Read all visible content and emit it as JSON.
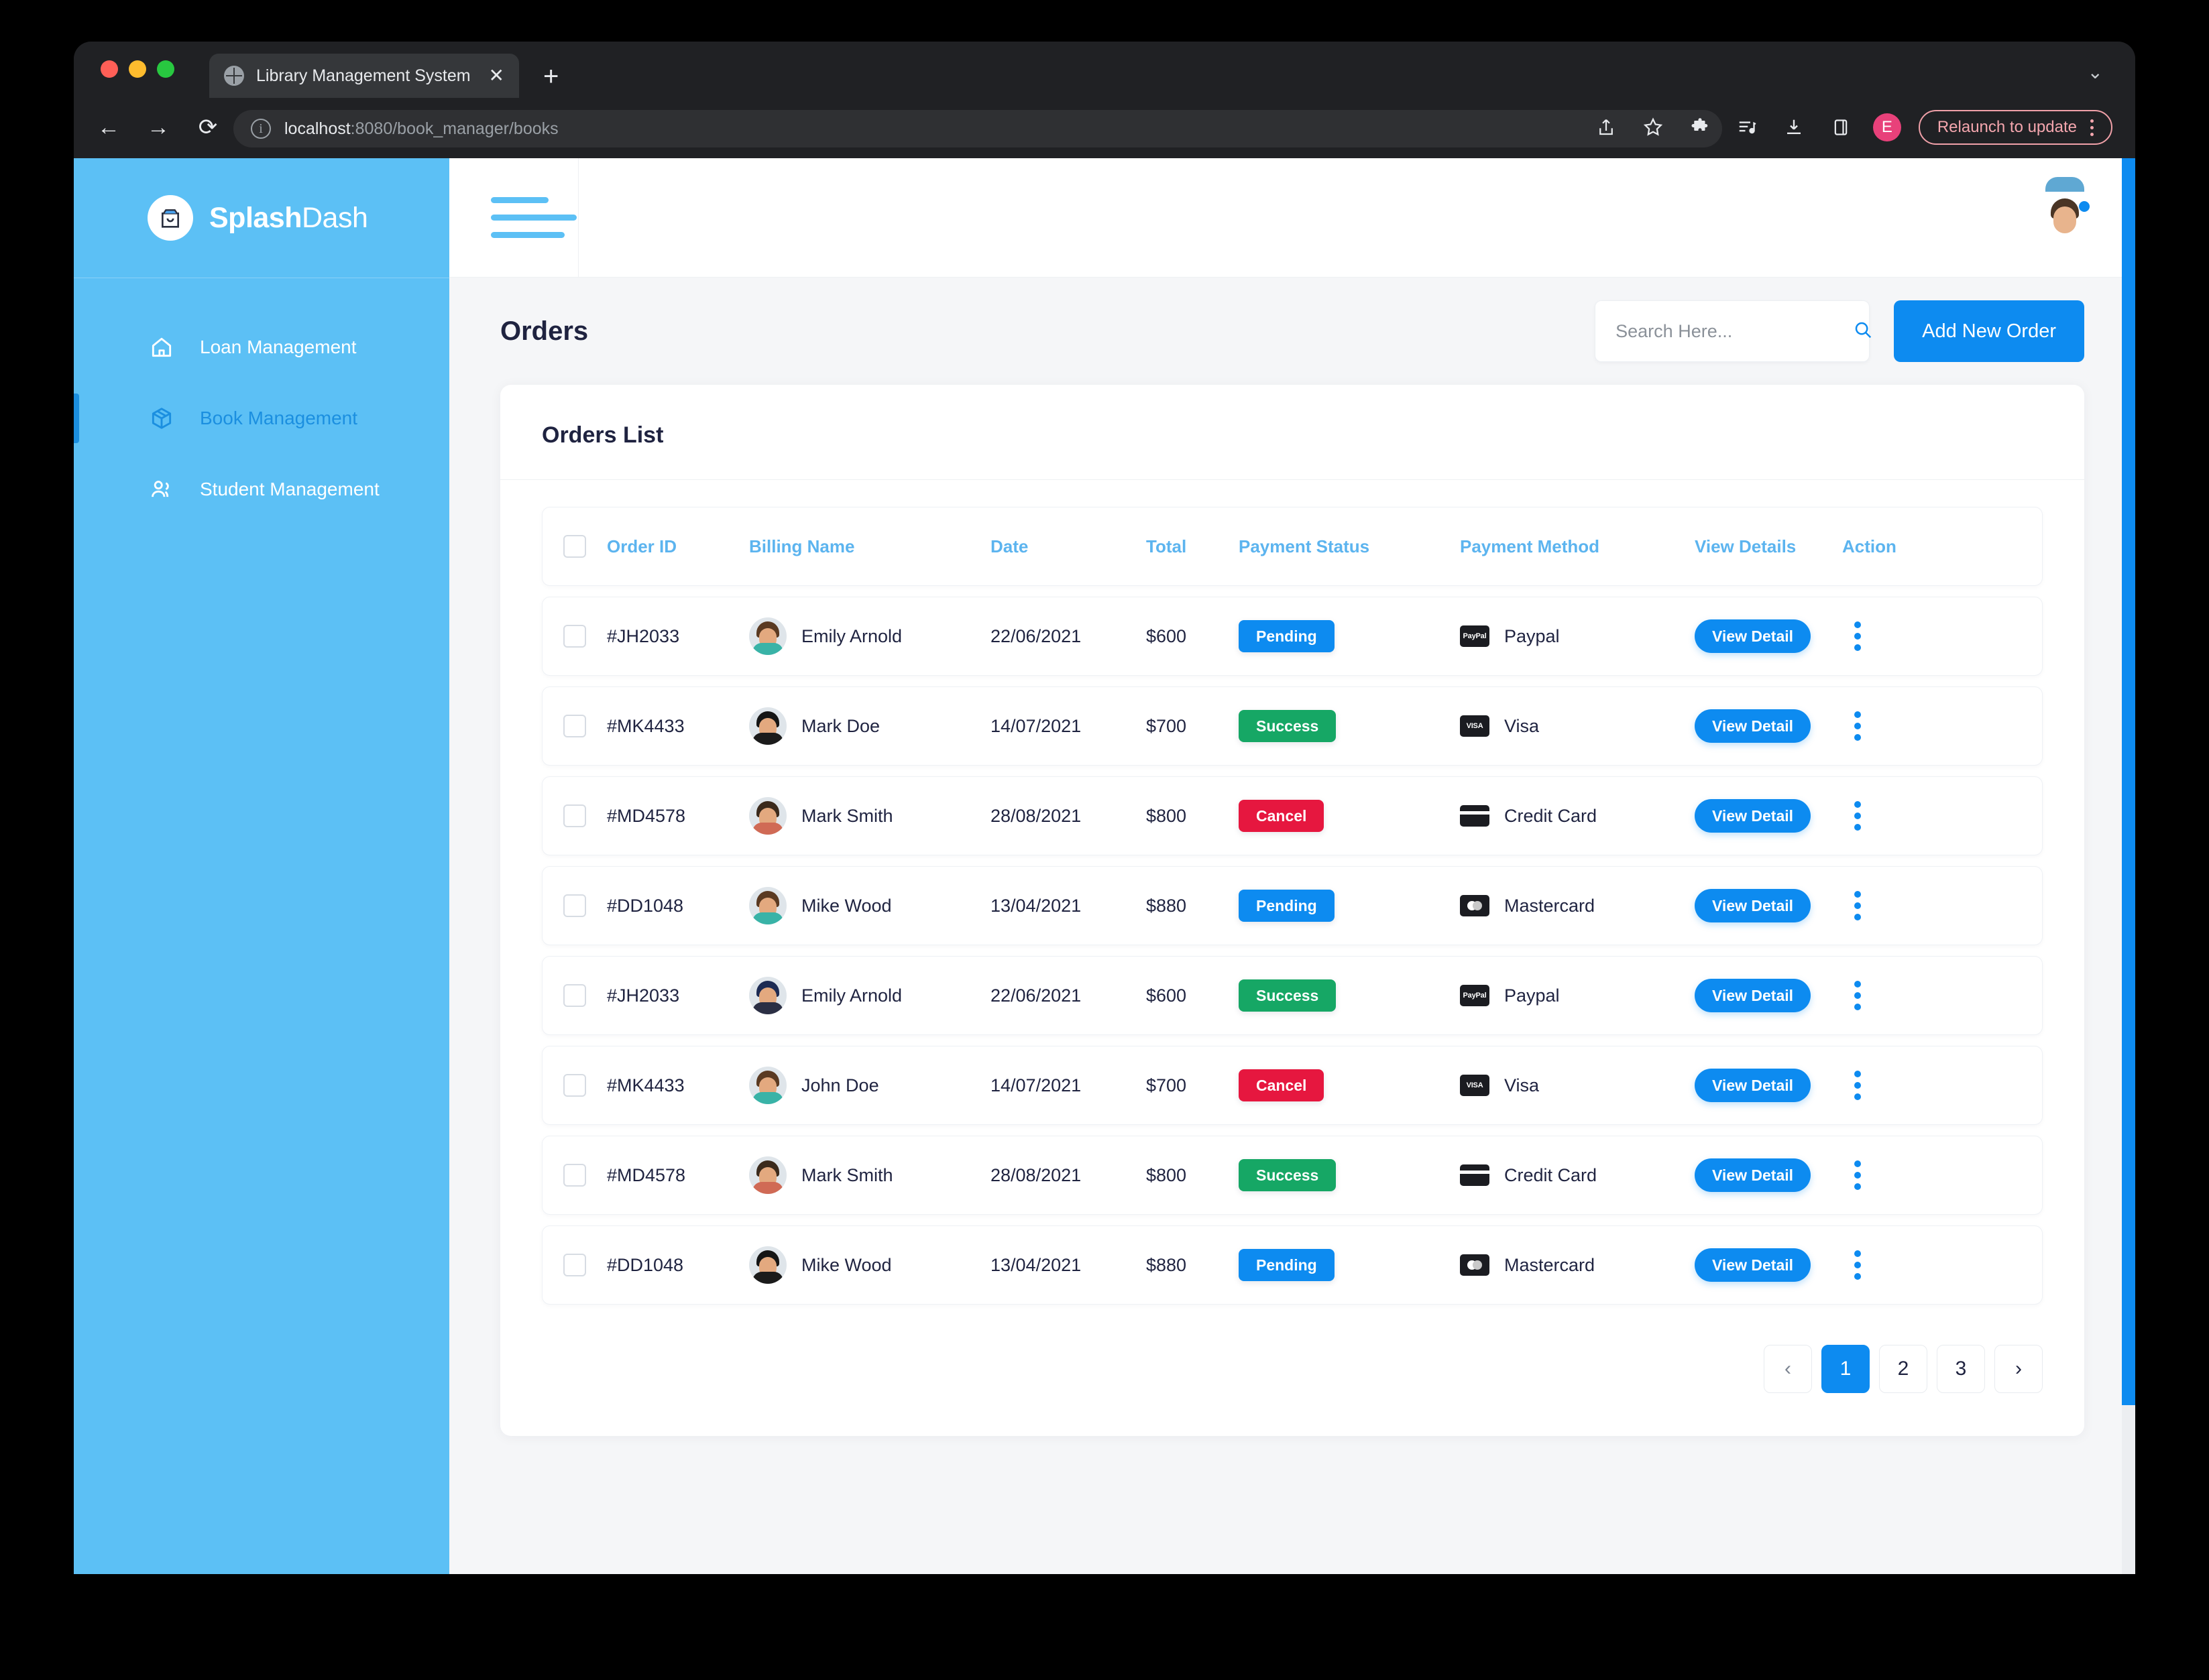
{
  "browser": {
    "tab_title": "Library Management System",
    "tab_close": "✕",
    "new_tab": "+",
    "tab_list_chevron": "⌄",
    "back": "←",
    "forward": "→",
    "reload": "⟳",
    "info_icon": "i",
    "url_host": "localhost",
    "url_path": ":8080/book_manager/books",
    "profile_initial": "E",
    "relaunch_label": "Relaunch to update"
  },
  "sidebar": {
    "brand_bold": "Splash",
    "brand_light": "Dash",
    "items": [
      {
        "label": "Loan Management",
        "icon": "home-icon",
        "active": false
      },
      {
        "label": "Book Management",
        "icon": "package-icon",
        "active": true
      },
      {
        "label": "Student Management",
        "icon": "users-icon",
        "active": false
      }
    ]
  },
  "topbar": {
    "menu_icon": "hamburger-icon",
    "avatar_icon": "user-avatar"
  },
  "page": {
    "title": "Orders",
    "search_placeholder": "Search Here...",
    "search_value": "",
    "search_icon": "search-icon",
    "add_button": "Add New Order",
    "card_title": "Orders List"
  },
  "table": {
    "columns": [
      "",
      "Order ID",
      "Billing Name",
      "Date",
      "Total",
      "Payment Status",
      "Payment Method",
      "View Details",
      "Action"
    ],
    "view_detail_label": "View Detail",
    "rows": [
      {
        "order_id": "#JH2033",
        "billing_name": "Emily Arnold",
        "date": "22/06/2021",
        "total": "$600",
        "status": "Pending",
        "status_kind": "pending",
        "method": "Paypal",
        "method_icon": "paypal-icon",
        "hair": "#5a3a22",
        "body": "#39b3a7"
      },
      {
        "order_id": "#MK4433",
        "billing_name": "Mark Doe",
        "date": "14/07/2021",
        "total": "$700",
        "status": "Success",
        "status_kind": "success",
        "method": "Visa",
        "method_icon": "visa-icon",
        "hair": "#151515",
        "body": "#1b1b1b"
      },
      {
        "order_id": "#MD4578",
        "billing_name": "Mark Smith",
        "date": "28/08/2021",
        "total": "$800",
        "status": "Cancel",
        "status_kind": "cancel",
        "method": "Credit Card",
        "method_icon": "credit-card-icon",
        "hair": "#3b2a1c",
        "body": "#d06a55"
      },
      {
        "order_id": "#DD1048",
        "billing_name": "Mike Wood",
        "date": "13/04/2021",
        "total": "$880",
        "status": "Pending",
        "status_kind": "pending",
        "method": "Mastercard",
        "method_icon": "mastercard-icon",
        "hair": "#5a3a22",
        "body": "#39b3a7"
      },
      {
        "order_id": "#JH2033",
        "billing_name": "Emily Arnold",
        "date": "22/06/2021",
        "total": "$600",
        "status": "Success",
        "status_kind": "success",
        "method": "Paypal",
        "method_icon": "paypal-icon",
        "hair": "#1d2b53",
        "body": "#2b2f44"
      },
      {
        "order_id": "#MK4433",
        "billing_name": "John Doe",
        "date": "14/07/2021",
        "total": "$700",
        "status": "Cancel",
        "status_kind": "cancel",
        "method": "Visa",
        "method_icon": "visa-icon",
        "hair": "#5a3a22",
        "body": "#39b3a7"
      },
      {
        "order_id": "#MD4578",
        "billing_name": "Mark Smith",
        "date": "28/08/2021",
        "total": "$800",
        "status": "Success",
        "status_kind": "success",
        "method": "Credit Card",
        "method_icon": "credit-card-icon",
        "hair": "#3b2a1c",
        "body": "#d06a55"
      },
      {
        "order_id": "#DD1048",
        "billing_name": "Mike Wood",
        "date": "13/04/2021",
        "total": "$880",
        "status": "Pending",
        "status_kind": "pending",
        "method": "Mastercard",
        "method_icon": "mastercard-icon",
        "hair": "#151515",
        "body": "#1b1b1b"
      }
    ]
  },
  "pagination": {
    "prev": "‹",
    "next": "›",
    "pages": [
      "1",
      "2",
      "3"
    ],
    "current": "1"
  },
  "colors": {
    "sidebar": "#5cc0f5",
    "accent": "#0d8bf0",
    "success": "#16a765",
    "danger": "#e6173f",
    "header_text": "#5cb4ef"
  }
}
